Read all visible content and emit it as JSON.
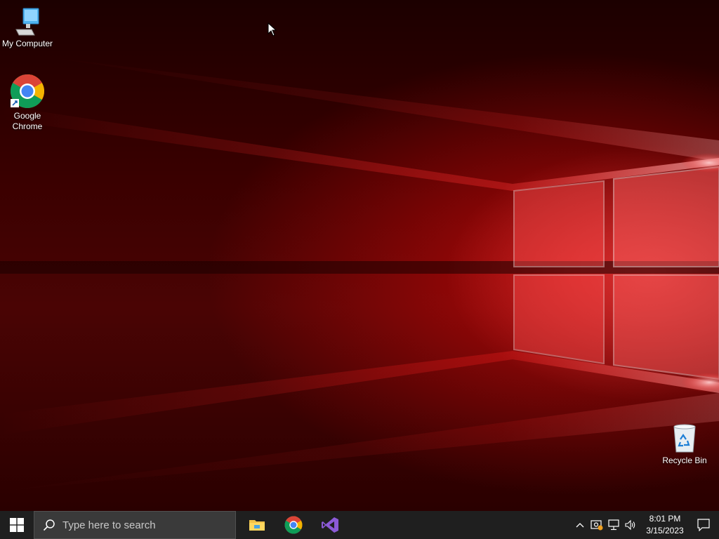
{
  "desktop": {
    "icons": [
      {
        "label": "My Computer",
        "icon": "computer-icon"
      },
      {
        "label": "Google Chrome",
        "icon": "chrome-icon"
      },
      {
        "label": "Recycle Bin",
        "icon": "recycle-bin-icon"
      }
    ]
  },
  "taskbar": {
    "search_placeholder": "Type here to search",
    "pinned": [
      "file-explorer-icon",
      "chrome-icon",
      "visual-studio-icon"
    ],
    "tray_icons": [
      "chevron-up-icon",
      "security-icon",
      "network-icon",
      "volume-icon"
    ],
    "clock": {
      "time": "8:01 PM",
      "date": "3/15/2023"
    }
  },
  "colors": {
    "wallpaper_accent": "#e01010",
    "taskbar_bg": "#1f1f1f",
    "search_bg": "#3a3a3a"
  }
}
